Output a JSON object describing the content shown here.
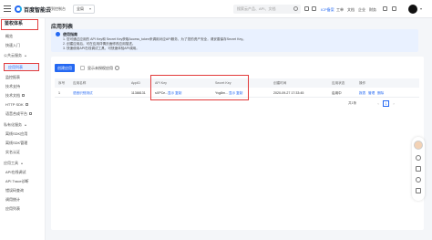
{
  "header": {
    "brand": "百度智能云",
    "back_link": "回到控制台",
    "region": "全局",
    "search_placeholder": "搜索云产品、API、文档",
    "items": [
      "ICP备案",
      "工单",
      "文档",
      "企业",
      "财务"
    ]
  },
  "sidebar": {
    "title": "鉴权体系",
    "items": [
      {
        "label": "概览",
        "type": "item"
      },
      {
        "label": "快速入门",
        "type": "item"
      },
      {
        "label": "公共云服务",
        "type": "group"
      },
      {
        "label": "应用列表",
        "type": "item",
        "active": true
      },
      {
        "label": "监控报表",
        "type": "item"
      },
      {
        "label": "技术支持",
        "type": "item"
      },
      {
        "label": "技术文档",
        "type": "item",
        "external": true
      },
      {
        "label": "HTTP SDK",
        "type": "item",
        "external": true
      },
      {
        "label": "语音合成平台",
        "type": "item",
        "external": true
      },
      {
        "label": "私有化服务",
        "type": "group"
      },
      {
        "label": "离线SDK应用",
        "type": "item"
      },
      {
        "label": "离线SDK管理",
        "type": "item"
      },
      {
        "label": "实名认证",
        "type": "item"
      },
      {
        "label": "应用工具",
        "type": "group"
      },
      {
        "label": "API在线调试",
        "type": "item"
      },
      {
        "label": "API Trace诊断",
        "type": "item"
      },
      {
        "label": "错误码查询",
        "type": "item"
      },
      {
        "label": "调用统计",
        "type": "item"
      },
      {
        "label": "应用列表",
        "type": "item"
      }
    ]
  },
  "page": {
    "title": "应用列表"
  },
  "notice": {
    "title": "使用指南",
    "lines": [
      "1. 您可通过应用的 API Key和 Secret Key获取Access_token来调用对应API服务，为了您的资产安全，请妥善保存Secret Key。",
      "2. 创建应用后，可在应用详情页面修改应用描述。",
      "3. 快速使用API在线调试工具，可快速体验API调用。"
    ]
  },
  "toolbar": {
    "create_label": "创建应用",
    "checkbox_label": "显示未授权应用"
  },
  "table": {
    "columns": [
      "序号",
      "应用名称",
      "AppID",
      "API Key",
      "Secret Key",
      "创建时间",
      "应用状态",
      "操作"
    ],
    "rows": [
      {
        "index": "1",
        "name": "语音识别测试",
        "app_id": "11388131",
        "api_key": "sXPCe...",
        "api_key_action": "显示 复制",
        "secret_key": "Yvg8m...",
        "secret_key_action": "显示 复制",
        "created": "2020-09-27 17:33:45",
        "status": "启用中",
        "actions": [
          "报表",
          "管理",
          "删除"
        ]
      }
    ]
  },
  "pagination": {
    "total": "共1条",
    "prev": "‹",
    "current": "1",
    "next": "›"
  }
}
